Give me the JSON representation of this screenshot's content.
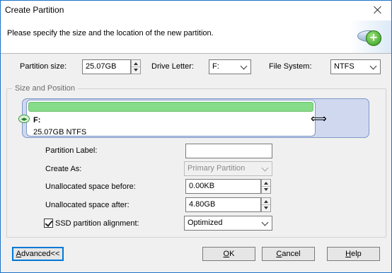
{
  "window": {
    "title": "Create Partition"
  },
  "header": {
    "instruction": "Please specify the size and the location of the new partition."
  },
  "top_fields": {
    "size_label": "Partition size:",
    "size_value": "25.07GB",
    "drive_label": "Drive Letter:",
    "drive_value": "F:",
    "fs_label": "File System:",
    "fs_value": "NTFS"
  },
  "group": {
    "title": "Size and Position"
  },
  "partition_map": {
    "letter": "F:",
    "info": "25.07GB NTFS"
  },
  "details": {
    "label_label": "Partition Label:",
    "label_value": "",
    "create_as_label": "Create As:",
    "create_as_value": "Primary Partition",
    "before_label": "Unallocated space before:",
    "before_value": "0.00KB",
    "after_label": "Unallocated space after:",
    "after_value": "4.80GB",
    "ssd_label": "SSD partition alignment:",
    "ssd_checked": true,
    "ssd_value": "Optimized"
  },
  "buttons": {
    "advanced": {
      "accel": "A",
      "rest": "dvanced<<"
    },
    "ok": {
      "accel": "O",
      "rest": "K"
    },
    "cancel": {
      "accel": "C",
      "rest": "ancel"
    },
    "help": {
      "accel": "H",
      "rest": "elp"
    }
  },
  "icons": {
    "close": "close-icon",
    "header": "disk-add-icon",
    "handle": "resize-handle-icon",
    "cursor": "horizontal-resize-cursor-icon"
  },
  "colors": {
    "partition_bar": "#86dc88",
    "disk_map": "#cfd8ee",
    "focus_border": "#0078d7"
  }
}
